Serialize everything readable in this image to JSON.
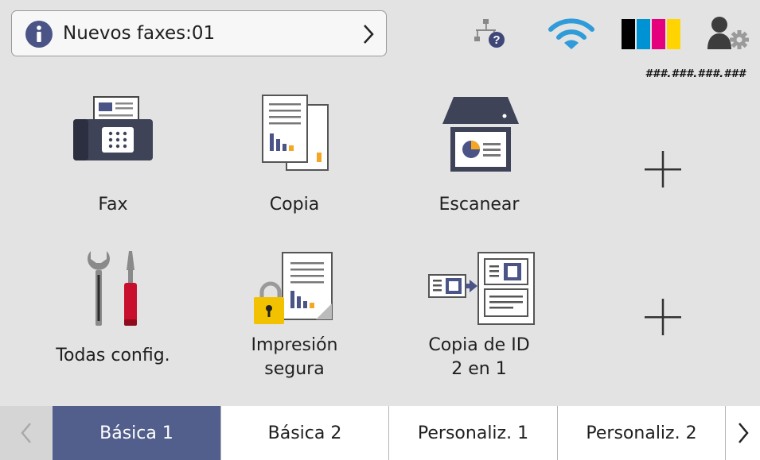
{
  "notification": {
    "text": "Nuevos faxes:01"
  },
  "status": {
    "ip_address": "###.###.###.###"
  },
  "tiles": [
    {
      "label": "Fax",
      "icon": "fax-icon"
    },
    {
      "label": "Copia",
      "icon": "copy-icon"
    },
    {
      "label": "Escanear",
      "icon": "scanner-icon"
    },
    {
      "label": "",
      "icon": "add-shortcut-icon"
    },
    {
      "label": "Todas config.",
      "icon": "settings-tools-icon"
    },
    {
      "label": "Impresión\nsegura",
      "icon": "secure-print-icon"
    },
    {
      "label": "Copia de ID\n2 en 1",
      "icon": "id-copy-icon"
    },
    {
      "label": "",
      "icon": "add-shortcut-icon"
    }
  ],
  "tabs": [
    {
      "label": "Básica 1",
      "active": true
    },
    {
      "label": "Básica 2",
      "active": false
    },
    {
      "label": "Personaliz. 1",
      "active": false
    },
    {
      "label": "Personaliz. 2",
      "active": false
    }
  ],
  "colors": {
    "accent": "#525e8b",
    "background": "#e3e3e3",
    "ink_black": "#000000",
    "ink_cyan": "#0093d4",
    "ink_magenta": "#e5007e",
    "ink_yellow": "#ffd400",
    "wifi": "#2f9bd9"
  }
}
